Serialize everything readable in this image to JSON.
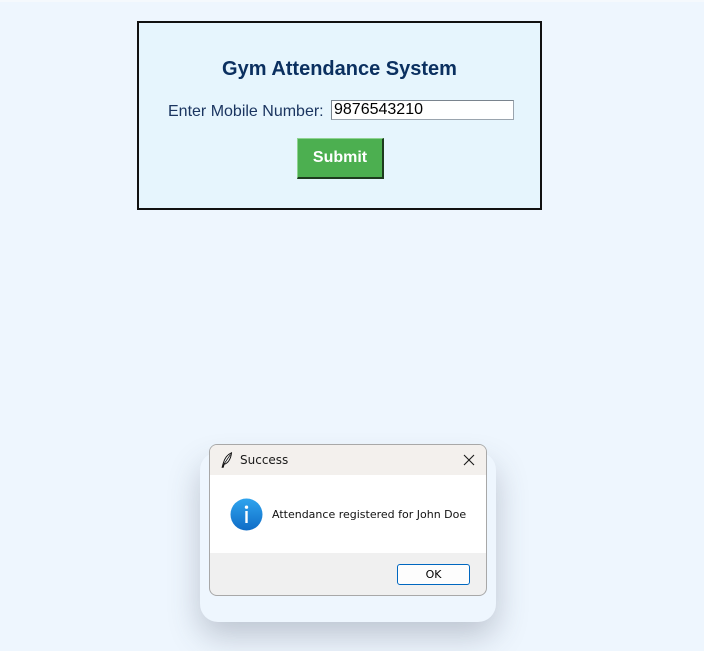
{
  "form": {
    "title": "Gym Attendance System",
    "mobile_label": "Enter Mobile Number:",
    "mobile_value": "9876543210",
    "submit_label": "Submit"
  },
  "dialog": {
    "title": "Success",
    "app_icon": "feather-icon",
    "close_icon": "close-icon",
    "message_icon": "info-icon",
    "message": "Attendance registered for John Doe",
    "ok_label": "OK"
  },
  "colors": {
    "background": "#eef6fe",
    "card_background": "#e6f5fd",
    "title_text": "#0b3060",
    "submit_button": "#4caf50",
    "info_icon": "#1a84d9",
    "ok_button_border": "#0067c0"
  }
}
